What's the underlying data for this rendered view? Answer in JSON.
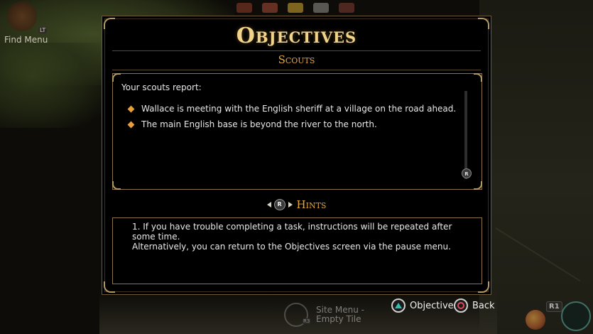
{
  "hud": {
    "find_menu_label": "Find Menu",
    "find_menu_button": "LT",
    "site_menu_line1": "Site Menu -",
    "site_menu_line2": "Empty Tile",
    "site_menu_button": "R3",
    "r1_label": "R1"
  },
  "dialog": {
    "title": "Objectives",
    "subtitle": "Scouts",
    "intro": "Your scouts report:",
    "objectives": [
      "Wallace is meeting with the English sheriff at a village on the road ahead.",
      "The main English base is beyond the river to the north."
    ],
    "scroll_button": "R",
    "hints_button": "R",
    "hints_title": "Hints",
    "hint_line1": "1. If you have trouble completing a task, instructions will be repeated after some time.",
    "hint_line2": "Alternatively, you can return to the Objectives screen via the pause menu."
  },
  "prompts": {
    "objectives_label": "Objectives",
    "back_label": "Back"
  },
  "colors": {
    "accent_gold": "#f1d48a",
    "accent_orange": "#e6a83a",
    "triangle": "#2fc0b0",
    "circle": "#e04858"
  }
}
